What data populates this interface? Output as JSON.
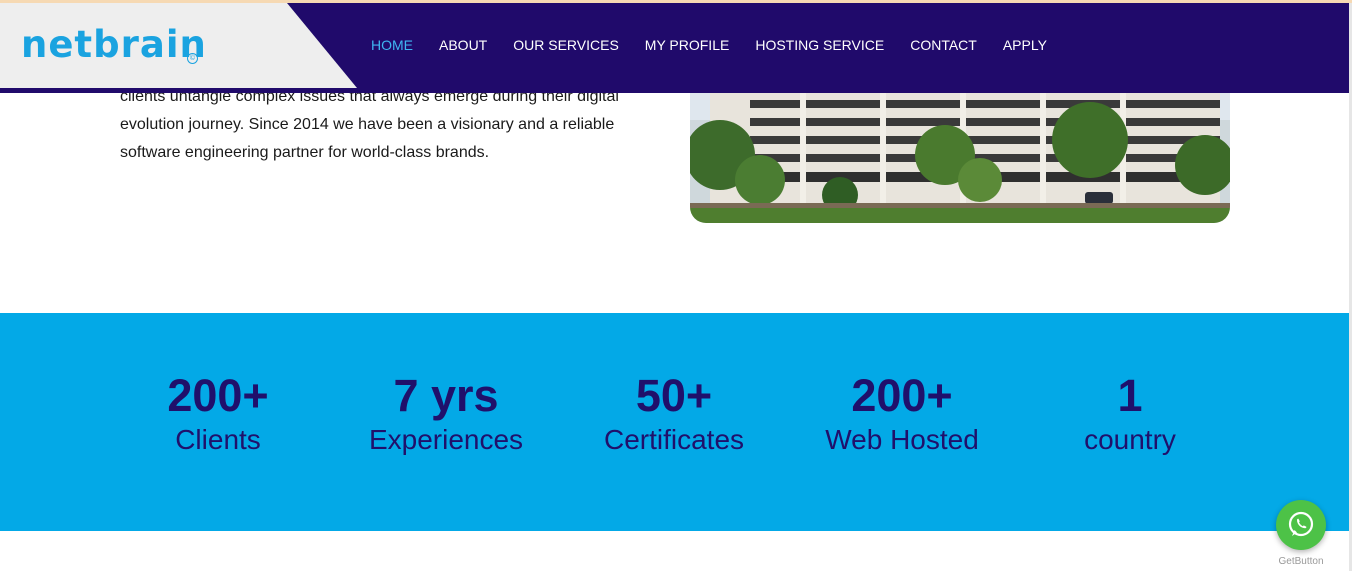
{
  "brand": {
    "logo_text": "netbrain",
    "logo_mark": "©"
  },
  "nav": {
    "items": [
      {
        "label": "HOME"
      },
      {
        "label": "ABOUT"
      },
      {
        "label": "OUR SERVICES"
      },
      {
        "label": "MY PROFILE"
      },
      {
        "label": "HOSTING SERVICE"
      },
      {
        "label": "CONTACT"
      },
      {
        "label": "APPLY"
      }
    ],
    "active_color": "#3fb6f2"
  },
  "intro": {
    "lines": [
      "clients untangle complex issues that always emerge during their digital",
      "evolution journey. Since 2014 we have been a visionary and a reliable",
      "software engineering partner for world-class brands."
    ]
  },
  "stats": [
    {
      "number": "200+",
      "label": "Clients"
    },
    {
      "number": "7 yrs",
      "label": "Experiences"
    },
    {
      "number": "50+",
      "label": "Certificates"
    },
    {
      "number": "200+",
      "label": "Web Hosted"
    },
    {
      "number": "1",
      "label": "country"
    }
  ],
  "widget": {
    "icon": "whatsapp-icon",
    "caption": "GetButton"
  },
  "colors": {
    "header_bg": "#200a6b",
    "stats_bg": "#03a9e7",
    "stats_text": "#20106b",
    "logo": "#1aa3e0",
    "whatsapp": "#4dc247"
  }
}
